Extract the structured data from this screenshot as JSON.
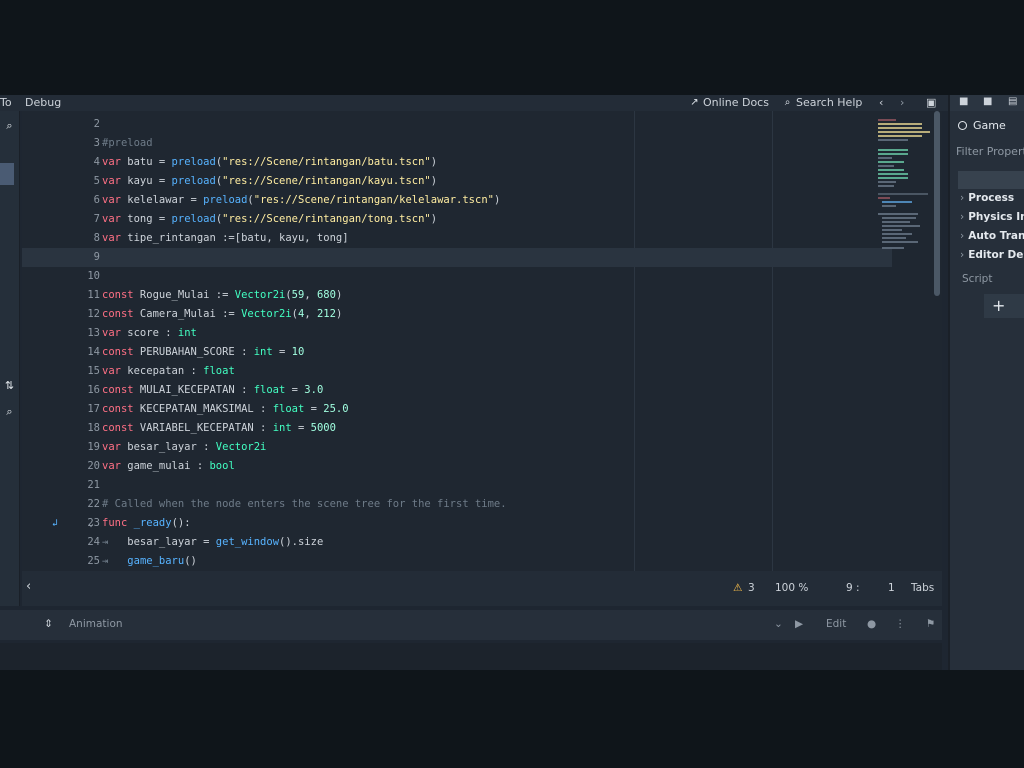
{
  "menu": {
    "item1": "To",
    "item2": "Debug",
    "online_docs": "Online Docs",
    "search_help": "Search Help"
  },
  "code_lines": [
    {
      "n": "2",
      "t": ""
    },
    {
      "n": "3",
      "t": "#preload"
    },
    {
      "n": "4",
      "t": "var batu = preload(\"res://Scene/rintangan/batu.tscn\")"
    },
    {
      "n": "5",
      "t": "var kayu = preload(\"res://Scene/rintangan/kayu.tscn\")"
    },
    {
      "n": "6",
      "t": "var kelelawar = preload(\"res://Scene/rintangan/kelelawar.tscn\")"
    },
    {
      "n": "7",
      "t": "var tong = preload(\"res://Scene/rintangan/tong.tscn\")"
    },
    {
      "n": "8",
      "t": "var tipe_rintangan :=[batu, kayu, tong]"
    },
    {
      "n": "9",
      "t": ""
    },
    {
      "n": "10",
      "t": ""
    },
    {
      "n": "11",
      "t": "const Rogue_Mulai := Vector2i(59, 680)"
    },
    {
      "n": "12",
      "t": "const Camera_Mulai := Vector2i(4, 212)"
    },
    {
      "n": "13",
      "t": "var score : int"
    },
    {
      "n": "14",
      "t": "const PERUBAHAN_SCORE : int = 10"
    },
    {
      "n": "15",
      "t": "var kecepatan : float"
    },
    {
      "n": "16",
      "t": "const MULAI_KECEPATAN : float = 3.0"
    },
    {
      "n": "17",
      "t": "const KECEPATAN_MAKSIMAL : float = 25.0"
    },
    {
      "n": "18",
      "t": "const VARIABEL_KECEPATAN : int = 5000"
    },
    {
      "n": "19",
      "t": "var besar_layar : Vector2i"
    },
    {
      "n": "20",
      "t": "var game_mulai : bool"
    },
    {
      "n": "21",
      "t": ""
    },
    {
      "n": "22",
      "t": "# Called when the node enters the scene tree for the first time."
    },
    {
      "n": "23",
      "t": "func _ready():"
    },
    {
      "n": "24",
      "t": "    besar_layar = get_window().size"
    },
    {
      "n": "25",
      "t": "    game_baru()"
    }
  ],
  "status": {
    "warnings": "3",
    "zoom": "100 %",
    "line": "9 :",
    "col": "1",
    "indent": "Tabs"
  },
  "bottom_panel": {
    "animation": "Animation",
    "edit": "Edit"
  },
  "dock": {
    "tab": "Game",
    "filter": "Filter Properties",
    "properties": [
      "Process",
      "Physics In",
      "Auto Trans",
      "Editor Des"
    ],
    "script_label": "Script",
    "add": "+"
  },
  "colors": {
    "keyword": "#ff7085",
    "string": "#ffeda1",
    "number": "#a1ffe0",
    "type": "#42ffc2",
    "comment": "#6e7b88",
    "function": "#57b3ff"
  }
}
